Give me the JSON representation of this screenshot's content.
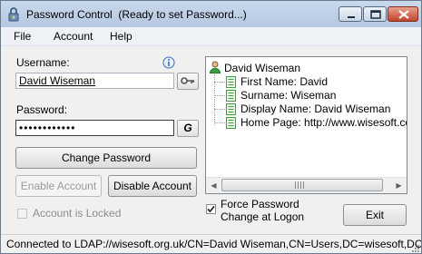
{
  "window": {
    "title": "Password Control  (Ready to set Password...)"
  },
  "menu": {
    "file": "File",
    "account": "Account",
    "help": "Help"
  },
  "form": {
    "username_label": "Username:",
    "username_value": "David Wiseman",
    "password_label": "Password:",
    "password_value": "••••••••••••",
    "generate_label": "G",
    "change_password": "Change Password",
    "enable_account": "Enable Account",
    "disable_account": "Disable Account",
    "account_locked": "Account is Locked",
    "force_password": "Force Password\nChange at Logon",
    "force_checked": "✔",
    "exit": "Exit"
  },
  "tree": {
    "root": "David Wiseman",
    "items": [
      "First Name: David",
      "Surname: Wiseman",
      "Display Name: David Wiseman",
      "Home Page: http://www.wisesoft.co.uk"
    ]
  },
  "status": {
    "text": "Connected to LDAP://wisesoft.org.uk/CN=David Wiseman,CN=Users,DC=wisesoft,DC=org,DC"
  },
  "icons": {
    "app": "key-lock-icon",
    "info": "info-icon",
    "key_button": "key-icon",
    "user": "user-icon",
    "property": "property-icon"
  },
  "colors": {
    "title_bar": "#c9d9ec",
    "close_button": "#c3432c",
    "tree_icon_green": "#3aa043"
  }
}
